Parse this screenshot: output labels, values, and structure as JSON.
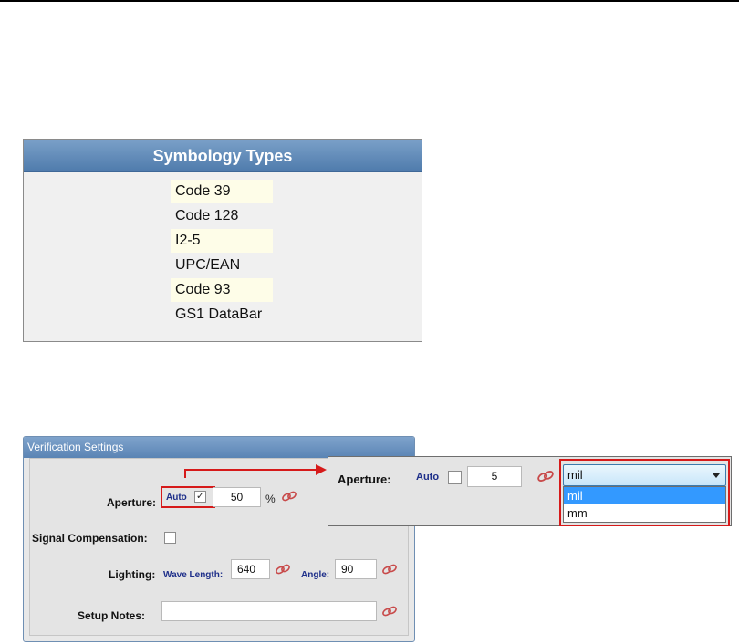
{
  "symbology": {
    "title": "Symbology Types",
    "items": [
      "Code 39",
      "Code 128",
      "I2-5",
      "UPC/EAN",
      "Code 93",
      "GS1 DataBar"
    ]
  },
  "verification": {
    "title": "Verification Settings",
    "aperture_label": "Aperture:",
    "auto_label": "Auto",
    "aperture_value": "50",
    "percent": "%",
    "signal_label": "Signal Compensation:",
    "lighting_label": "Lighting:",
    "wavelength_label": "Wave Length:",
    "wavelength_value": "640",
    "angle_label": "Angle:",
    "angle_value": "90",
    "notes_label": "Setup Notes:",
    "notes_value": ""
  },
  "inset": {
    "aperture_label": "Aperture:",
    "auto_label": "Auto",
    "aperture_value": "5",
    "unit_selected": "mil",
    "unit_options": [
      "mil",
      "mm"
    ]
  },
  "colors": {
    "header_blue": "#5a84b4",
    "highlight_red": "#d61a1a",
    "selection_blue": "#3399ff",
    "link_red": "#c84a4a"
  }
}
